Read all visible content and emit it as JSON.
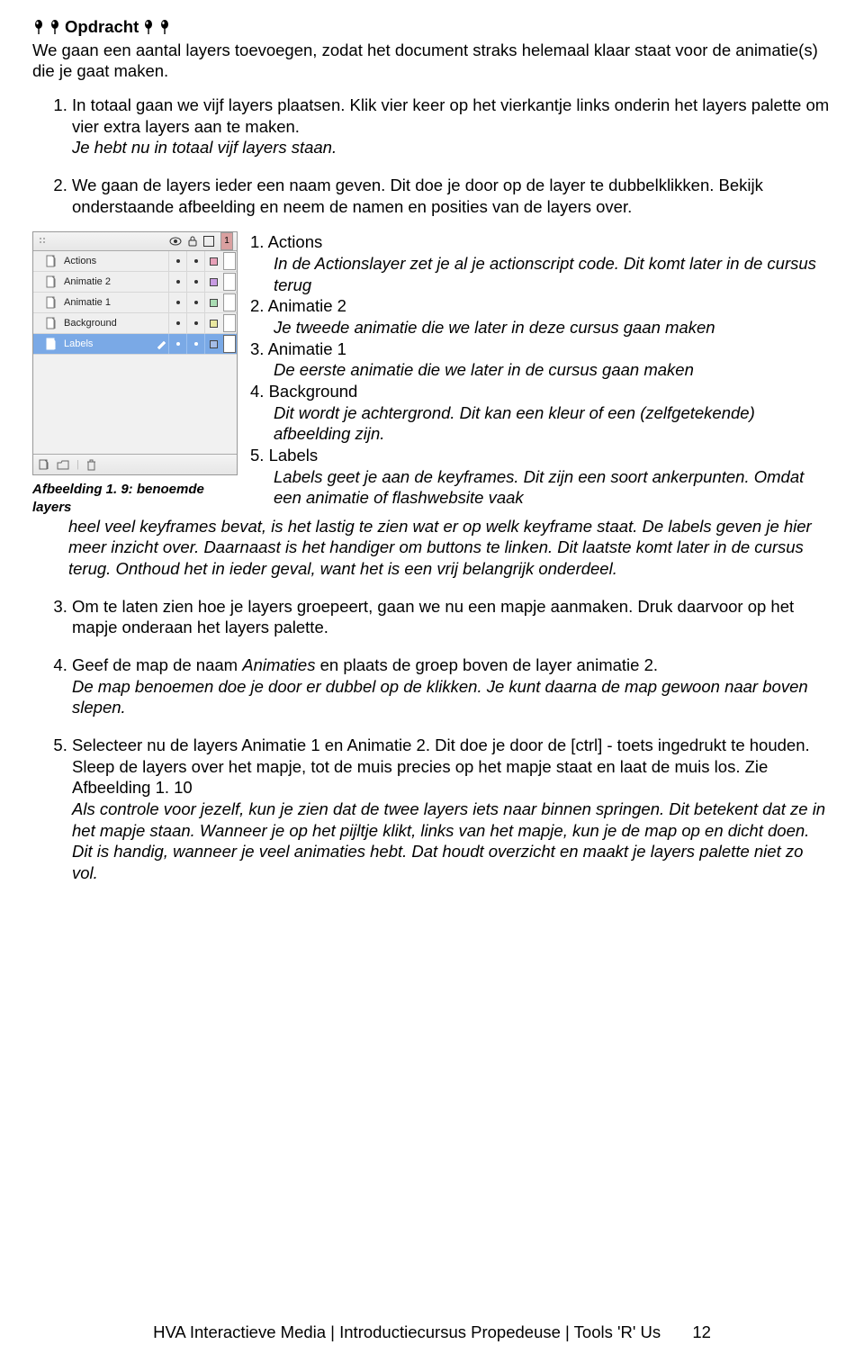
{
  "heading": "Opdracht",
  "intro": "We gaan een aantal layers toevoegen, zodat het document straks helemaal klaar staat voor de animatie(s) die je gaat maken.",
  "figure": {
    "caption": "Afbeelding 1. 9: benoemde layers",
    "header_frame": "1",
    "layers": [
      {
        "name": "Actions",
        "color": "pink",
        "selected": false
      },
      {
        "name": "Animatie 2",
        "color": "purple",
        "selected": false
      },
      {
        "name": "Animatie 1",
        "color": "green",
        "selected": false
      },
      {
        "name": "Background",
        "color": "yellow",
        "selected": false
      },
      {
        "name": "Labels",
        "color": "blue",
        "selected": true
      }
    ]
  },
  "steps": {
    "s1": {
      "line1": "In totaal gaan we vijf layers plaatsen. Klik vier keer op het vierkantje links onderin het layers palette om vier extra layers aan te maken.",
      "line2": "Je hebt nu in totaal vijf layers staan."
    },
    "s2": {
      "text": "We gaan de layers ieder een naam geven. Dit doe je door op de layer te dubbelklikken. Bekijk onderstaande afbeelding en neem de namen en posities van de layers over."
    },
    "layer_items": [
      {
        "n": "1.",
        "title": "Actions",
        "desc": "In de Actionslayer zet je al je actionscript code. Dit komt later in de cursus terug"
      },
      {
        "n": "2.",
        "title": "Animatie 2",
        "desc": "Je tweede animatie die we later in deze cursus gaan maken"
      },
      {
        "n": "3.",
        "title": "Animatie 1",
        "desc": "De eerste animatie die we later in de cursus gaan maken"
      },
      {
        "n": "4.",
        "title": "Background",
        "desc": "Dit wordt je achtergrond. Dit kan een kleur of een (zelfgetekende) afbeelding zijn."
      },
      {
        "n": "5.",
        "title": "Labels",
        "desc": "Labels geet je aan de keyframes. Dit zijn een soort ankerpunten. Omdat een animatie of flashwebsite vaak"
      }
    ],
    "labels_cont": "heel veel keyframes bevat, is het lastig te zien wat er op welk keyframe staat. De labels geven je hier meer inzicht over. Daarnaast is het handiger om buttons te linken. Dit laatste komt later in de cursus terug. Onthoud het in ieder geval, want het is een vrij belangrijk onderdeel.",
    "s3": "Om te laten zien hoe je layers groepeert, gaan we nu een mapje aanmaken. Druk daarvoor op het mapje onderaan het layers palette.",
    "s4_part1": "Geef de map de naam ",
    "s4_name": "Animaties",
    "s4_part2": " en plaats de groep boven de layer animatie 2.",
    "s4_line2": "De map benoemen doe je door er dubbel op de klikken. Je kunt daarna de map gewoon naar boven slepen.",
    "s5_part1": "Selecteer nu de layers Animatie 1 en Animatie 2. Dit doe je door de [ctrl] - toets ingedrukt te houden. Sleep de layers over het mapje, tot de muis precies op het mapje staat en laat de muis los. Zie Afbeelding 1. 10",
    "s5_part2": "Als controle voor jezelf, kun je zien dat de twee layers iets naar binnen springen. Dit betekent dat ze in het mapje staan. Wanneer je op het pijltje klikt, links van het mapje, kun je de map op en dicht doen. Dit is handig, wanneer je veel animaties hebt. Dat houdt overzicht en maakt je layers palette niet zo vol."
  },
  "footer": {
    "text": "HVA Interactieve Media  |  Introductiecursus Propedeuse  |  Tools 'R' Us",
    "page": "12"
  }
}
